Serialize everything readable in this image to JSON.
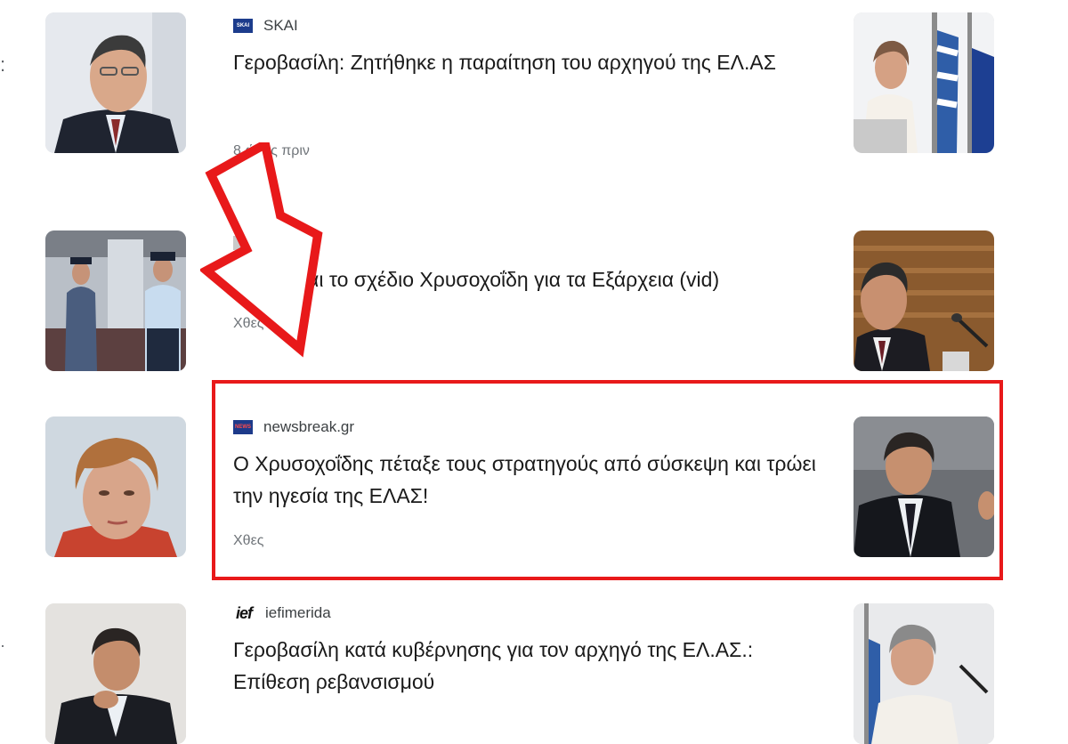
{
  "articles": [
    {
      "source": "SKAI",
      "source_logo": "skai-logo-icon",
      "headline": "Γεροβασίλη: Ζητήθηκε η παραίτηση του αρχηγού της ΕΛ.ΑΣ",
      "time": "8 ώρες πριν",
      "left_image": "man-in-suit-photo",
      "right_image": "woman-with-flags-photo"
    },
    {
      "source": "",
      "source_logo": "source-logo-icon",
      "headline": "Αυτό είναι το σχέδιο Χρυσοχοΐδη για τα Εξάρχεια (vid)",
      "time": "Χθες",
      "left_image": "police-officers-photo",
      "right_image": "man-at-podium-photo"
    },
    {
      "source": "newsbreak.gr",
      "source_logo": "newsbreak-logo-icon",
      "headline": "Ο Χρυσοχοΐδης πέταξε τους στρατηγούς από σύσκεψη και τρώει την ηγεσία της ΕΛΑΣ!",
      "time": "Χθες",
      "left_image": "woman-portrait-photo",
      "right_image": "man-speaking-photo"
    },
    {
      "source": "iefimerida",
      "source_logo": "ief-logo-icon",
      "headline": "Γεροβασίλη κατά κυβέρνησης για τον αρχηγό της ΕΛ.ΑΣ.: Επίθεση ρεβανσισμού",
      "time": "",
      "left_image": "man-hand-on-chin-photo",
      "right_image": "woman-speaking-photo"
    }
  ],
  "logos": {
    "skai": "SKAI",
    "newsbreak": "NEWS",
    "ief": "ief"
  },
  "colors": {
    "highlight": "#e8191a",
    "arrow": "#e8191a",
    "time_text": "#70757a"
  }
}
